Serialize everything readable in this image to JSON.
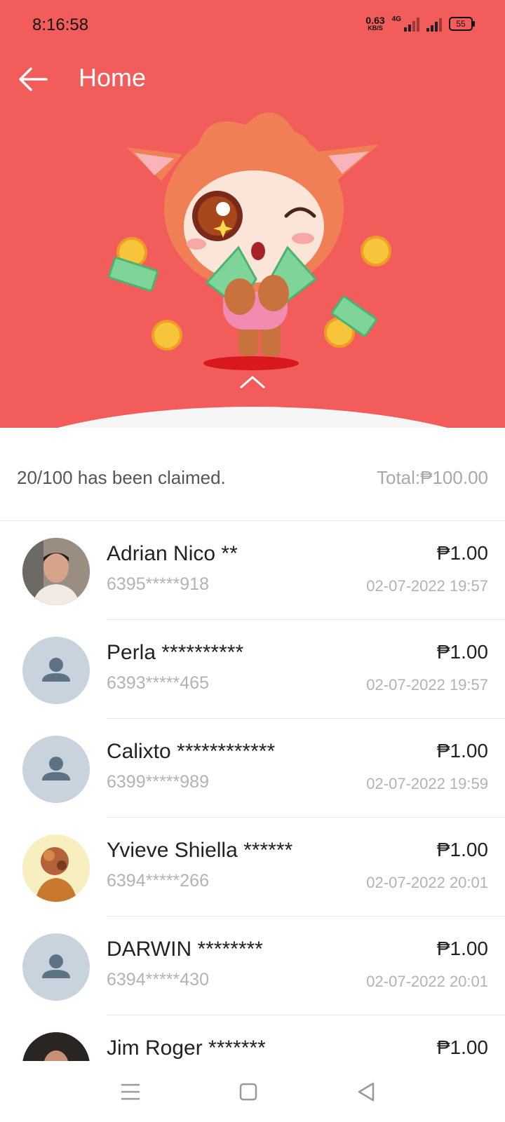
{
  "status_bar": {
    "time": "8:16:58",
    "net_speed": "0.63",
    "net_unit": "KB/S",
    "network_type": "4G",
    "battery": "55"
  },
  "header": {
    "title": "Home",
    "background_color": "#f25c5a"
  },
  "summary": {
    "claimed_text": "20/100 has been claimed.",
    "total_text": "Total:₱100.00"
  },
  "claims": [
    {
      "name": "Adrian Nico **",
      "phone": "6395*****918",
      "amount": "₱1.00",
      "date": "02-07-2022 19:57",
      "avatar": "photo"
    },
    {
      "name": "Perla **********",
      "phone": "6393*****465",
      "amount": "₱1.00",
      "date": "02-07-2022 19:57",
      "avatar": "default"
    },
    {
      "name": "Calixto ************",
      "phone": "6399*****989",
      "amount": "₱1.00",
      "date": "02-07-2022 19:59",
      "avatar": "default"
    },
    {
      "name": "Yvieve Shiella ******",
      "phone": "6394*****266",
      "amount": "₱1.00",
      "date": "02-07-2022 20:01",
      "avatar": "photo"
    },
    {
      "name": "DARWIN ********",
      "phone": "6394*****430",
      "amount": "₱1.00",
      "date": "02-07-2022 20:01",
      "avatar": "default"
    },
    {
      "name": "Jim Roger *******",
      "phone": "",
      "amount": "₱1.00",
      "date": "",
      "avatar": "photo"
    }
  ],
  "icons": {
    "back": "arrow-left-icon",
    "expand": "chevron-up-icon",
    "default_avatar": "person-icon",
    "nav": [
      "menu-icon",
      "home-square-icon",
      "back-triangle-icon"
    ]
  }
}
